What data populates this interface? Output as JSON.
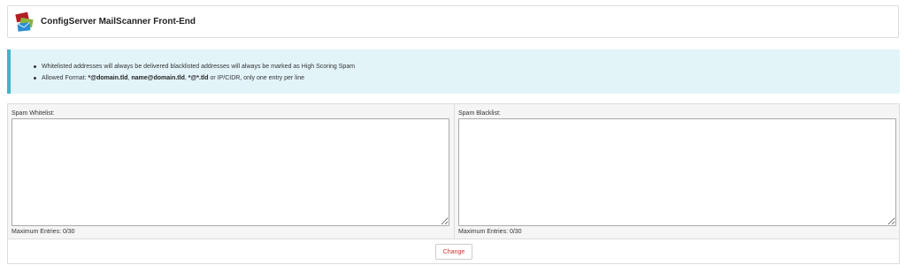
{
  "header": {
    "title": "ConfigServer MailScanner Front-End",
    "logo_icon": "envelopes-logo-icon"
  },
  "info": {
    "line1": "Whitelisted addresses will always be delivered blacklisted addresses will always be marked as High Scoring Spam",
    "line2": {
      "prefix": "Allowed Format: ",
      "fmt1": "*@domain.tld",
      "sep1": ", ",
      "fmt2": "name@domain.tld",
      "sep2": ", ",
      "fmt3": "*@*.tld",
      "suffix": " or IP/CIDR, only one entry per line"
    }
  },
  "whitelist": {
    "label": "Spam Whitelist:",
    "value": "",
    "count": "Maximum Entries: 0/30"
  },
  "blacklist": {
    "label": "Spam Blacklist:",
    "value": "",
    "count": "Maximum Entries: 0/30"
  },
  "actions": {
    "change_label": "Change"
  },
  "colors": {
    "info_bg": "#e3f4f9",
    "info_accent": "#3fb5c9",
    "button_text": "#c0392b"
  }
}
